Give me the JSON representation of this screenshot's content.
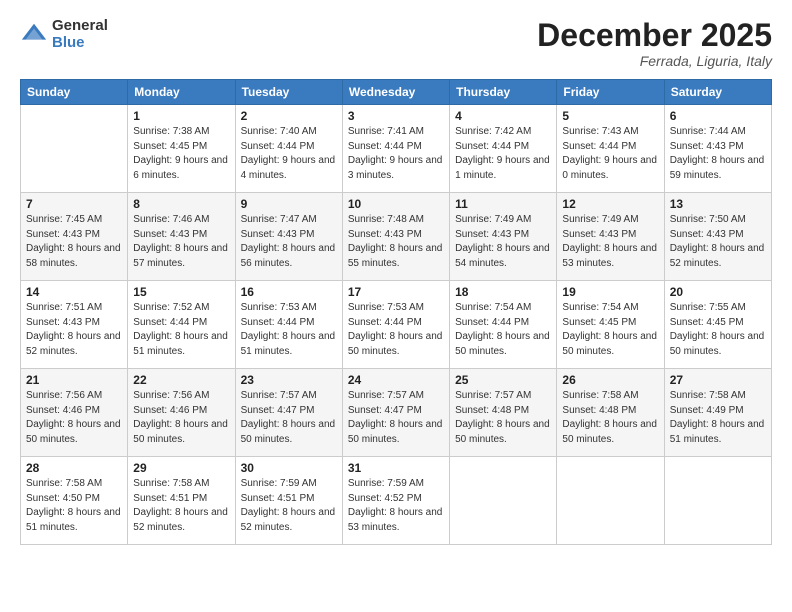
{
  "logo": {
    "general": "General",
    "blue": "Blue"
  },
  "title": "December 2025",
  "location": "Ferrada, Liguria, Italy",
  "headers": [
    "Sunday",
    "Monday",
    "Tuesday",
    "Wednesday",
    "Thursday",
    "Friday",
    "Saturday"
  ],
  "weeks": [
    [
      {
        "day": "",
        "sunrise": "",
        "sunset": "",
        "daylight": ""
      },
      {
        "day": "1",
        "sunrise": "Sunrise: 7:38 AM",
        "sunset": "Sunset: 4:45 PM",
        "daylight": "Daylight: 9 hours and 6 minutes."
      },
      {
        "day": "2",
        "sunrise": "Sunrise: 7:40 AM",
        "sunset": "Sunset: 4:44 PM",
        "daylight": "Daylight: 9 hours and 4 minutes."
      },
      {
        "day": "3",
        "sunrise": "Sunrise: 7:41 AM",
        "sunset": "Sunset: 4:44 PM",
        "daylight": "Daylight: 9 hours and 3 minutes."
      },
      {
        "day": "4",
        "sunrise": "Sunrise: 7:42 AM",
        "sunset": "Sunset: 4:44 PM",
        "daylight": "Daylight: 9 hours and 1 minute."
      },
      {
        "day": "5",
        "sunrise": "Sunrise: 7:43 AM",
        "sunset": "Sunset: 4:44 PM",
        "daylight": "Daylight: 9 hours and 0 minutes."
      },
      {
        "day": "6",
        "sunrise": "Sunrise: 7:44 AM",
        "sunset": "Sunset: 4:43 PM",
        "daylight": "Daylight: 8 hours and 59 minutes."
      }
    ],
    [
      {
        "day": "7",
        "sunrise": "Sunrise: 7:45 AM",
        "sunset": "Sunset: 4:43 PM",
        "daylight": "Daylight: 8 hours and 58 minutes."
      },
      {
        "day": "8",
        "sunrise": "Sunrise: 7:46 AM",
        "sunset": "Sunset: 4:43 PM",
        "daylight": "Daylight: 8 hours and 57 minutes."
      },
      {
        "day": "9",
        "sunrise": "Sunrise: 7:47 AM",
        "sunset": "Sunset: 4:43 PM",
        "daylight": "Daylight: 8 hours and 56 minutes."
      },
      {
        "day": "10",
        "sunrise": "Sunrise: 7:48 AM",
        "sunset": "Sunset: 4:43 PM",
        "daylight": "Daylight: 8 hours and 55 minutes."
      },
      {
        "day": "11",
        "sunrise": "Sunrise: 7:49 AM",
        "sunset": "Sunset: 4:43 PM",
        "daylight": "Daylight: 8 hours and 54 minutes."
      },
      {
        "day": "12",
        "sunrise": "Sunrise: 7:49 AM",
        "sunset": "Sunset: 4:43 PM",
        "daylight": "Daylight: 8 hours and 53 minutes."
      },
      {
        "day": "13",
        "sunrise": "Sunrise: 7:50 AM",
        "sunset": "Sunset: 4:43 PM",
        "daylight": "Daylight: 8 hours and 52 minutes."
      }
    ],
    [
      {
        "day": "14",
        "sunrise": "Sunrise: 7:51 AM",
        "sunset": "Sunset: 4:43 PM",
        "daylight": "Daylight: 8 hours and 52 minutes."
      },
      {
        "day": "15",
        "sunrise": "Sunrise: 7:52 AM",
        "sunset": "Sunset: 4:44 PM",
        "daylight": "Daylight: 8 hours and 51 minutes."
      },
      {
        "day": "16",
        "sunrise": "Sunrise: 7:53 AM",
        "sunset": "Sunset: 4:44 PM",
        "daylight": "Daylight: 8 hours and 51 minutes."
      },
      {
        "day": "17",
        "sunrise": "Sunrise: 7:53 AM",
        "sunset": "Sunset: 4:44 PM",
        "daylight": "Daylight: 8 hours and 50 minutes."
      },
      {
        "day": "18",
        "sunrise": "Sunrise: 7:54 AM",
        "sunset": "Sunset: 4:44 PM",
        "daylight": "Daylight: 8 hours and 50 minutes."
      },
      {
        "day": "19",
        "sunrise": "Sunrise: 7:54 AM",
        "sunset": "Sunset: 4:45 PM",
        "daylight": "Daylight: 8 hours and 50 minutes."
      },
      {
        "day": "20",
        "sunrise": "Sunrise: 7:55 AM",
        "sunset": "Sunset: 4:45 PM",
        "daylight": "Daylight: 8 hours and 50 minutes."
      }
    ],
    [
      {
        "day": "21",
        "sunrise": "Sunrise: 7:56 AM",
        "sunset": "Sunset: 4:46 PM",
        "daylight": "Daylight: 8 hours and 50 minutes."
      },
      {
        "day": "22",
        "sunrise": "Sunrise: 7:56 AM",
        "sunset": "Sunset: 4:46 PM",
        "daylight": "Daylight: 8 hours and 50 minutes."
      },
      {
        "day": "23",
        "sunrise": "Sunrise: 7:57 AM",
        "sunset": "Sunset: 4:47 PM",
        "daylight": "Daylight: 8 hours and 50 minutes."
      },
      {
        "day": "24",
        "sunrise": "Sunrise: 7:57 AM",
        "sunset": "Sunset: 4:47 PM",
        "daylight": "Daylight: 8 hours and 50 minutes."
      },
      {
        "day": "25",
        "sunrise": "Sunrise: 7:57 AM",
        "sunset": "Sunset: 4:48 PM",
        "daylight": "Daylight: 8 hours and 50 minutes."
      },
      {
        "day": "26",
        "sunrise": "Sunrise: 7:58 AM",
        "sunset": "Sunset: 4:48 PM",
        "daylight": "Daylight: 8 hours and 50 minutes."
      },
      {
        "day": "27",
        "sunrise": "Sunrise: 7:58 AM",
        "sunset": "Sunset: 4:49 PM",
        "daylight": "Daylight: 8 hours and 51 minutes."
      }
    ],
    [
      {
        "day": "28",
        "sunrise": "Sunrise: 7:58 AM",
        "sunset": "Sunset: 4:50 PM",
        "daylight": "Daylight: 8 hours and 51 minutes."
      },
      {
        "day": "29",
        "sunrise": "Sunrise: 7:58 AM",
        "sunset": "Sunset: 4:51 PM",
        "daylight": "Daylight: 8 hours and 52 minutes."
      },
      {
        "day": "30",
        "sunrise": "Sunrise: 7:59 AM",
        "sunset": "Sunset: 4:51 PM",
        "daylight": "Daylight: 8 hours and 52 minutes."
      },
      {
        "day": "31",
        "sunrise": "Sunrise: 7:59 AM",
        "sunset": "Sunset: 4:52 PM",
        "daylight": "Daylight: 8 hours and 53 minutes."
      },
      {
        "day": "",
        "sunrise": "",
        "sunset": "",
        "daylight": ""
      },
      {
        "day": "",
        "sunrise": "",
        "sunset": "",
        "daylight": ""
      },
      {
        "day": "",
        "sunrise": "",
        "sunset": "",
        "daylight": ""
      }
    ]
  ]
}
